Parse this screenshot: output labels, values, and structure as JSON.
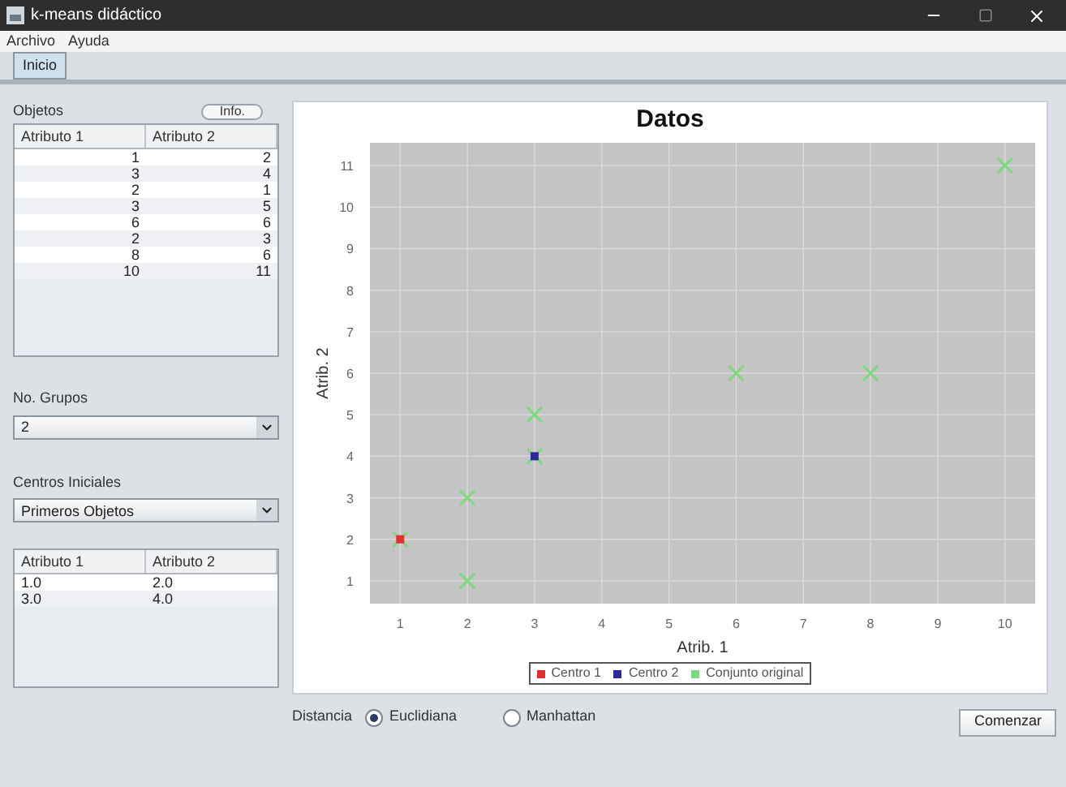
{
  "window": {
    "title": "k-means didáctico"
  },
  "menu": [
    "Archivo",
    "Ayuda"
  ],
  "tabs": [
    {
      "label": "Inicio",
      "selected": true
    }
  ],
  "objects": {
    "label": "Objetos",
    "info_button": "Info.",
    "columns": [
      "Atributo 1",
      "Atributo 2"
    ],
    "rows": [
      [
        "1",
        "2"
      ],
      [
        "3",
        "4"
      ],
      [
        "2",
        "1"
      ],
      [
        "3",
        "5"
      ],
      [
        "6",
        "6"
      ],
      [
        "2",
        "3"
      ],
      [
        "8",
        "6"
      ],
      [
        "10",
        "11"
      ]
    ]
  },
  "groups": {
    "label": "No. Grupos",
    "value": "2"
  },
  "initial_centers": {
    "label": "Centros Iniciales",
    "value": "Primeros Objetos",
    "columns": [
      "Atributo 1",
      "Atributo 2"
    ],
    "rows": [
      [
        "1.0",
        "2.0"
      ],
      [
        "3.0",
        "4.0"
      ]
    ]
  },
  "chart": {
    "chart_data": {
      "type": "scatter",
      "title": "Datos",
      "xlabel": "Atrib. 1",
      "ylabel": "Atrib. 2",
      "xlim": [
        0.55,
        10.45
      ],
      "ylim": [
        0.45,
        11.55
      ],
      "xticks": [
        1,
        2,
        3,
        4,
        5,
        6,
        7,
        8,
        9,
        10
      ],
      "yticks": [
        1,
        2,
        3,
        4,
        5,
        6,
        7,
        8,
        9,
        10,
        11
      ],
      "grid": true,
      "legend": "bottom",
      "x": [
        1,
        3,
        2,
        3,
        6,
        2,
        8,
        10
      ],
      "series": [
        {
          "name": "Centro 1",
          "color": "#e03030",
          "values": [
            2,
            null,
            null,
            null,
            null,
            null,
            null,
            null
          ]
        },
        {
          "name": "Centro 2",
          "color": "#2a2a9a",
          "values": [
            null,
            4,
            null,
            null,
            null,
            null,
            null,
            null
          ]
        },
        {
          "name": "Conjunto original",
          "color": "#7fd87f",
          "values": [
            2,
            4,
            1,
            5,
            6,
            3,
            6,
            11
          ]
        }
      ]
    }
  },
  "distance": {
    "label": "Distancia",
    "options": [
      {
        "label": "Euclidiana",
        "selected": true
      },
      {
        "label": "Manhattan",
        "selected": false
      }
    ]
  },
  "start_button": "Comenzar"
}
